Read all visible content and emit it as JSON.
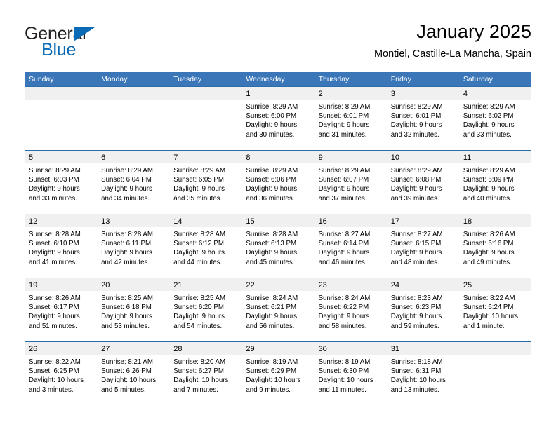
{
  "logo": {
    "word_one": "General",
    "word_two": "Blue",
    "triangle_icon": "triangle-icon",
    "brand_color": "#0a6ab5"
  },
  "header": {
    "title": "January 2025",
    "subtitle": "Montiel, Castille-La Mancha, Spain"
  },
  "theme": {
    "header_blue": "#3a76b8",
    "row_border_blue": "#2b6cab",
    "day_strip_gray": "#f0f0f0"
  },
  "weekdays": [
    "Sunday",
    "Monday",
    "Tuesday",
    "Wednesday",
    "Thursday",
    "Friday",
    "Saturday"
  ],
  "weeks": [
    [
      {
        "day": "",
        "lines": []
      },
      {
        "day": "",
        "lines": []
      },
      {
        "day": "",
        "lines": []
      },
      {
        "day": "1",
        "lines": [
          "Sunrise: 8:29 AM",
          "Sunset: 6:00 PM",
          "Daylight: 9 hours",
          "and 30 minutes."
        ]
      },
      {
        "day": "2",
        "lines": [
          "Sunrise: 8:29 AM",
          "Sunset: 6:01 PM",
          "Daylight: 9 hours",
          "and 31 minutes."
        ]
      },
      {
        "day": "3",
        "lines": [
          "Sunrise: 8:29 AM",
          "Sunset: 6:01 PM",
          "Daylight: 9 hours",
          "and 32 minutes."
        ]
      },
      {
        "day": "4",
        "lines": [
          "Sunrise: 8:29 AM",
          "Sunset: 6:02 PM",
          "Daylight: 9 hours",
          "and 33 minutes."
        ]
      }
    ],
    [
      {
        "day": "5",
        "lines": [
          "Sunrise: 8:29 AM",
          "Sunset: 6:03 PM",
          "Daylight: 9 hours",
          "and 33 minutes."
        ]
      },
      {
        "day": "6",
        "lines": [
          "Sunrise: 8:29 AM",
          "Sunset: 6:04 PM",
          "Daylight: 9 hours",
          "and 34 minutes."
        ]
      },
      {
        "day": "7",
        "lines": [
          "Sunrise: 8:29 AM",
          "Sunset: 6:05 PM",
          "Daylight: 9 hours",
          "and 35 minutes."
        ]
      },
      {
        "day": "8",
        "lines": [
          "Sunrise: 8:29 AM",
          "Sunset: 6:06 PM",
          "Daylight: 9 hours",
          "and 36 minutes."
        ]
      },
      {
        "day": "9",
        "lines": [
          "Sunrise: 8:29 AM",
          "Sunset: 6:07 PM",
          "Daylight: 9 hours",
          "and 37 minutes."
        ]
      },
      {
        "day": "10",
        "lines": [
          "Sunrise: 8:29 AM",
          "Sunset: 6:08 PM",
          "Daylight: 9 hours",
          "and 39 minutes."
        ]
      },
      {
        "day": "11",
        "lines": [
          "Sunrise: 8:29 AM",
          "Sunset: 6:09 PM",
          "Daylight: 9 hours",
          "and 40 minutes."
        ]
      }
    ],
    [
      {
        "day": "12",
        "lines": [
          "Sunrise: 8:28 AM",
          "Sunset: 6:10 PM",
          "Daylight: 9 hours",
          "and 41 minutes."
        ]
      },
      {
        "day": "13",
        "lines": [
          "Sunrise: 8:28 AM",
          "Sunset: 6:11 PM",
          "Daylight: 9 hours",
          "and 42 minutes."
        ]
      },
      {
        "day": "14",
        "lines": [
          "Sunrise: 8:28 AM",
          "Sunset: 6:12 PM",
          "Daylight: 9 hours",
          "and 44 minutes."
        ]
      },
      {
        "day": "15",
        "lines": [
          "Sunrise: 8:28 AM",
          "Sunset: 6:13 PM",
          "Daylight: 9 hours",
          "and 45 minutes."
        ]
      },
      {
        "day": "16",
        "lines": [
          "Sunrise: 8:27 AM",
          "Sunset: 6:14 PM",
          "Daylight: 9 hours",
          "and 46 minutes."
        ]
      },
      {
        "day": "17",
        "lines": [
          "Sunrise: 8:27 AM",
          "Sunset: 6:15 PM",
          "Daylight: 9 hours",
          "and 48 minutes."
        ]
      },
      {
        "day": "18",
        "lines": [
          "Sunrise: 8:26 AM",
          "Sunset: 6:16 PM",
          "Daylight: 9 hours",
          "and 49 minutes."
        ]
      }
    ],
    [
      {
        "day": "19",
        "lines": [
          "Sunrise: 8:26 AM",
          "Sunset: 6:17 PM",
          "Daylight: 9 hours",
          "and 51 minutes."
        ]
      },
      {
        "day": "20",
        "lines": [
          "Sunrise: 8:25 AM",
          "Sunset: 6:18 PM",
          "Daylight: 9 hours",
          "and 53 minutes."
        ]
      },
      {
        "day": "21",
        "lines": [
          "Sunrise: 8:25 AM",
          "Sunset: 6:20 PM",
          "Daylight: 9 hours",
          "and 54 minutes."
        ]
      },
      {
        "day": "22",
        "lines": [
          "Sunrise: 8:24 AM",
          "Sunset: 6:21 PM",
          "Daylight: 9 hours",
          "and 56 minutes."
        ]
      },
      {
        "day": "23",
        "lines": [
          "Sunrise: 8:24 AM",
          "Sunset: 6:22 PM",
          "Daylight: 9 hours",
          "and 58 minutes."
        ]
      },
      {
        "day": "24",
        "lines": [
          "Sunrise: 8:23 AM",
          "Sunset: 6:23 PM",
          "Daylight: 9 hours",
          "and 59 minutes."
        ]
      },
      {
        "day": "25",
        "lines": [
          "Sunrise: 8:22 AM",
          "Sunset: 6:24 PM",
          "Daylight: 10 hours",
          "and 1 minute."
        ]
      }
    ],
    [
      {
        "day": "26",
        "lines": [
          "Sunrise: 8:22 AM",
          "Sunset: 6:25 PM",
          "Daylight: 10 hours",
          "and 3 minutes."
        ]
      },
      {
        "day": "27",
        "lines": [
          "Sunrise: 8:21 AM",
          "Sunset: 6:26 PM",
          "Daylight: 10 hours",
          "and 5 minutes."
        ]
      },
      {
        "day": "28",
        "lines": [
          "Sunrise: 8:20 AM",
          "Sunset: 6:27 PM",
          "Daylight: 10 hours",
          "and 7 minutes."
        ]
      },
      {
        "day": "29",
        "lines": [
          "Sunrise: 8:19 AM",
          "Sunset: 6:29 PM",
          "Daylight: 10 hours",
          "and 9 minutes."
        ]
      },
      {
        "day": "30",
        "lines": [
          "Sunrise: 8:19 AM",
          "Sunset: 6:30 PM",
          "Daylight: 10 hours",
          "and 11 minutes."
        ]
      },
      {
        "day": "31",
        "lines": [
          "Sunrise: 8:18 AM",
          "Sunset: 6:31 PM",
          "Daylight: 10 hours",
          "and 13 minutes."
        ]
      },
      {
        "day": "",
        "lines": []
      }
    ]
  ]
}
